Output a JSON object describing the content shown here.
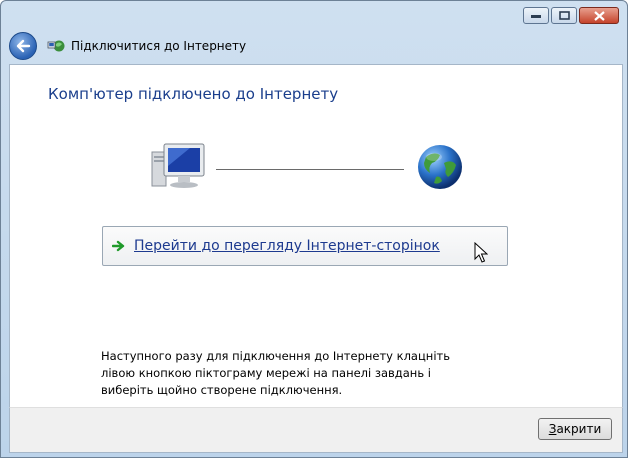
{
  "window": {
    "title": "Підключитися до Інтернету",
    "caption_buttons": [
      "minimize",
      "maximize",
      "close"
    ]
  },
  "main": {
    "heading": "Комп'ютер підключено до Інтернету",
    "link_text": "Перейти до перегляду Інтернет-сторінок",
    "info_text": "Наступного разу для підключення до Інтернету клацніть лівою кнопкою піктограму мережі на панелі завдань і виберіть щойно створене підключення."
  },
  "footer": {
    "close_first": "З",
    "close_rest": "акрити"
  },
  "icons": {
    "back": "back-arrow-icon",
    "network": "network-icon",
    "computer": "computer-icon",
    "globe": "globe-icon",
    "link_arrow": "green-arrow-icon",
    "cursor": "mouse-pointer-icon"
  },
  "colors": {
    "heading": "#1a3e8c",
    "link": "#1d3a8f",
    "frame": "#bcd3ea",
    "close_button": "#c5432b"
  }
}
